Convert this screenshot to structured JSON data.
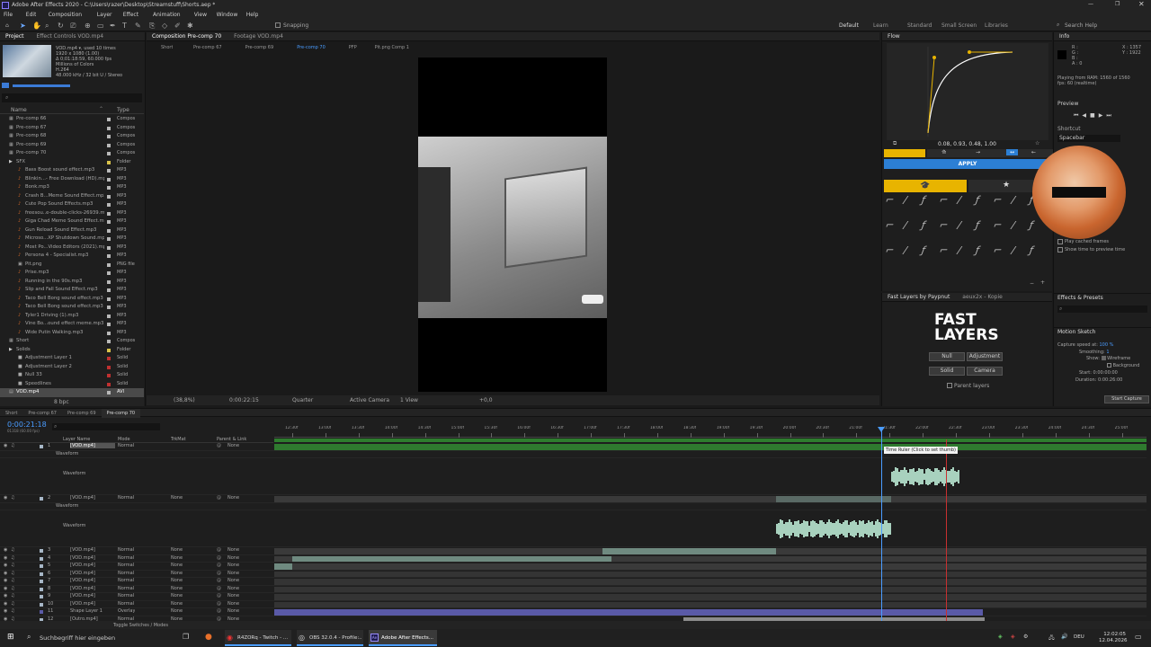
{
  "window": {
    "title": "Adobe After Effects 2020 - C:\\Users\\razer\\Desktop\\Streamstuff\\Shorts.aep *"
  },
  "menu": [
    "File",
    "Edit",
    "Composition",
    "Layer",
    "Effect",
    "Animation",
    "View",
    "Window",
    "Help"
  ],
  "toolbar": {
    "snapping": "Snapping",
    "workspaces": [
      "Default",
      "Learn",
      "Standard",
      "Small Screen",
      "Libraries"
    ],
    "search": "Search Help"
  },
  "project": {
    "tabs": [
      "Project",
      "Effect Controls VOD.mp4"
    ],
    "info": [
      "VOD.mp4 ▾, used 10 times",
      "1920 x 1080 (1.00)",
      "Δ 0;01:18:59, 60.000 fps",
      "Millions of Colors",
      "H.264",
      "48.000 kHz / 32 bit U / Stereo"
    ],
    "columns": {
      "name": "Name",
      "type": "Type"
    },
    "items": [
      {
        "name": "Pre-comp 66",
        "type": "Compos",
        "color": "#b8b8b8",
        "indent": 0,
        "kind": "comp"
      },
      {
        "name": "Pre-comp 67",
        "type": "Compos",
        "color": "#b8b8b8",
        "indent": 0,
        "kind": "comp"
      },
      {
        "name": "Pre-comp 68",
        "type": "Compos",
        "color": "#b8b8b8",
        "indent": 0,
        "kind": "comp"
      },
      {
        "name": "Pre-comp 69",
        "type": "Compos",
        "color": "#b8b8b8",
        "indent": 0,
        "kind": "comp"
      },
      {
        "name": "Pre-comp 70",
        "type": "Compos",
        "color": "#b8b8b8",
        "indent": 0,
        "kind": "comp"
      },
      {
        "name": "SFX",
        "type": "Folder",
        "color": "#d8c24a",
        "indent": 0,
        "kind": "folder"
      },
      {
        "name": "Bass Boost sound effect.mp3",
        "type": "MP3",
        "color": "#b8b8b8",
        "indent": 1,
        "kind": "audio"
      },
      {
        "name": "Blinkin...- Free Download (HD).mp3",
        "type": "MP3",
        "color": "#b8b8b8",
        "indent": 1,
        "kind": "audio"
      },
      {
        "name": "Bonk.mp3",
        "type": "MP3",
        "color": "#b8b8b8",
        "indent": 1,
        "kind": "audio"
      },
      {
        "name": "Crash B...Meme Sound Effect.mp3",
        "type": "MP3",
        "color": "#b8b8b8",
        "indent": 1,
        "kind": "audio"
      },
      {
        "name": "Cute Pop Sound Effects.mp3",
        "type": "MP3",
        "color": "#b8b8b8",
        "indent": 1,
        "kind": "audio"
      },
      {
        "name": "freesou..e-double-clicks-26939.mp3",
        "type": "MP3",
        "color": "#b8b8b8",
        "indent": 1,
        "kind": "audio"
      },
      {
        "name": "Giga Chad Meme Sound Effect.mp3",
        "type": "MP3",
        "color": "#b8b8b8",
        "indent": 1,
        "kind": "audio"
      },
      {
        "name": "Gun Reload Sound Effect.mp3",
        "type": "MP3",
        "color": "#b8b8b8",
        "indent": 1,
        "kind": "audio"
      },
      {
        "name": "Microso...XP Shutdown Sound.mp3",
        "type": "MP3",
        "color": "#b8b8b8",
        "indent": 1,
        "kind": "audio"
      },
      {
        "name": "Most Po...Video Editors (2021).mp3",
        "type": "MP3",
        "color": "#b8b8b8",
        "indent": 1,
        "kind": "audio"
      },
      {
        "name": "Persona 4 - Specialist.mp3",
        "type": "MP3",
        "color": "#b8b8b8",
        "indent": 1,
        "kind": "audio"
      },
      {
        "name": "Pit.png",
        "type": "PNG file",
        "color": "#b8b8b8",
        "indent": 1,
        "kind": "image"
      },
      {
        "name": "Prise.mp3",
        "type": "MP3",
        "color": "#b8b8b8",
        "indent": 1,
        "kind": "audio"
      },
      {
        "name": "Running in the 90s.mp3",
        "type": "MP3",
        "color": "#b8b8b8",
        "indent": 1,
        "kind": "audio"
      },
      {
        "name": "Slip and Fall Sound Effect.mp3",
        "type": "MP3",
        "color": "#b8b8b8",
        "indent": 1,
        "kind": "audio"
      },
      {
        "name": "Taco Bell Bong sound effect.mp3",
        "type": "MP3",
        "color": "#b8b8b8",
        "indent": 1,
        "kind": "audio"
      },
      {
        "name": "Taco Bell Bong sound effect.mp3",
        "type": "MP3",
        "color": "#b8b8b8",
        "indent": 1,
        "kind": "audio"
      },
      {
        "name": "Tyler1 Driving (1).mp3",
        "type": "MP3",
        "color": "#b8b8b8",
        "indent": 1,
        "kind": "audio"
      },
      {
        "name": "Vine Bo...ound effect meme.mp3",
        "type": "MP3",
        "color": "#b8b8b8",
        "indent": 1,
        "kind": "audio"
      },
      {
        "name": "Wide Putin Walking.mp3",
        "type": "MP3",
        "color": "#b8b8b8",
        "indent": 1,
        "kind": "audio"
      },
      {
        "name": "Short",
        "type": "Compos",
        "color": "#b8b8b8",
        "indent": 0,
        "kind": "comp"
      },
      {
        "name": "Solids",
        "type": "Folder",
        "color": "#d8c24a",
        "indent": 0,
        "kind": "folder"
      },
      {
        "name": "Adjustment Layer 1",
        "type": "Solid",
        "color": "#c03030",
        "indent": 1,
        "kind": "solid"
      },
      {
        "name": "Adjustment Layer 2",
        "type": "Solid",
        "color": "#c03030",
        "indent": 1,
        "kind": "solid"
      },
      {
        "name": "Null 33",
        "type": "Solid",
        "color": "#c03030",
        "indent": 1,
        "kind": "solid"
      },
      {
        "name": "Speedlines",
        "type": "Solid",
        "color": "#c03030",
        "indent": 1,
        "kind": "solid"
      },
      {
        "name": "VOD.mp4",
        "type": "AVI",
        "color": "#b8b8b8",
        "indent": 0,
        "kind": "video",
        "selected": true
      }
    ],
    "footer": "8 bpc"
  },
  "composition": {
    "tabs": [
      "Composition Pre-comp 70",
      "Footage VOD.mp4"
    ],
    "breadcrumbs": [
      "Short",
      "Pre-comp 67",
      "Pre-comp 69",
      "Pre-comp 70",
      "PFP",
      "Pit.png Comp 1"
    ],
    "footer": {
      "zoom": "(38,8%)",
      "time": "0:00:22:15",
      "resolution": "Quarter",
      "camera": "Active Camera",
      "view": "1 View",
      "exposure": "+0,0"
    }
  },
  "flow": {
    "title": "Flow",
    "values": "0.08, 0.93, 0.48, 1.00",
    "apply": "APPLY"
  },
  "info": {
    "title": "Info",
    "r": "R :",
    "g": "G :",
    "b": "B :",
    "a": "A : 0",
    "x": "X : 1357",
    "y": "Y : 1922",
    "playing": "Playing from RAM: 1560 of 1560",
    "fps": "fps: 60 (realtime)"
  },
  "preview": {
    "title": "Preview",
    "shortcut": "Shortcut",
    "key": "Spacebar",
    "cached": "Play cached frames",
    "show_time": "Show time to preview time"
  },
  "fastlayers": {
    "tabs": [
      "Fast Layers by Paypnut",
      "aeux2x - Kopie"
    ],
    "logo_top": "FAST",
    "logo_bottom": "LAYERS",
    "buttons": [
      "Null",
      "Adjustment",
      "Solid",
      "Camera"
    ],
    "parent": "Parent layers"
  },
  "effects": {
    "title": "Effects & Presets"
  },
  "motion_sketch": {
    "title": "Motion Sketch",
    "capture_label": "Capture speed at:",
    "capture_value": "100 %",
    "smoothing_label": "Smoothing:",
    "smoothing_value": "1",
    "show_label": "Show:",
    "wireframe": "Wireframe",
    "background": "Background",
    "start_label": "Start:",
    "start_value": "0:00:00:00",
    "duration_label": "Duration:",
    "duration_value": "0:00:26:00",
    "button": "Start Capture"
  },
  "timeline": {
    "tabs": [
      "Short",
      "Pre-comp 67",
      "Pre-comp 69",
      "Pre-comp 70"
    ],
    "timecode": "0:00:21:18",
    "timecode_sub": "01318 (60.00 fps)",
    "columns": {
      "name": "Layer Name",
      "mode": "Mode",
      "trkmat": "TrkMat",
      "parent": "Parent & Link"
    },
    "ruler": [
      "12:30f",
      "13:00f",
      "13:30f",
      "14:00f",
      "14:30f",
      "15:00f",
      "15:30f",
      "16:00f",
      "16:30f",
      "17:00f",
      "17:30f",
      "18:00f",
      "18:30f",
      "19:00f",
      "19:30f",
      "20:00f",
      "20:30f",
      "21:00f",
      "21:30f",
      "22:00f",
      "22:30f",
      "23:00f",
      "23:30f",
      "24:00f",
      "24:30f",
      "25:00f"
    ],
    "tooltip": "Time Ruler (Click to set thumb)",
    "footer": "Toggle Switches / Modes",
    "layers": [
      {
        "num": "1",
        "name": "[VOD.mp4]",
        "mode": "Normal",
        "trk": "",
        "parent": "None",
        "kind": "video"
      },
      {
        "num": "",
        "name": "Waveform",
        "mode": "",
        "trk": "",
        "parent": "",
        "kind": "sub"
      },
      {
        "num": "",
        "name": "Waveform",
        "mode": "",
        "trk": "",
        "parent": "",
        "kind": "wave"
      },
      {
        "num": "2",
        "name": "[VOD.mp4]",
        "mode": "Normal",
        "trk": "None",
        "parent": "None",
        "kind": "video"
      },
      {
        "num": "",
        "name": "Waveform",
        "mode": "",
        "trk": "",
        "parent": "",
        "kind": "sub"
      },
      {
        "num": "",
        "name": "Waveform",
        "mode": "",
        "trk": "",
        "parent": "",
        "kind": "wave"
      },
      {
        "num": "3",
        "name": "[VOD.mp4]",
        "mode": "Normal",
        "trk": "None",
        "parent": "None",
        "kind": "video"
      },
      {
        "num": "4",
        "name": "[VOD.mp4]",
        "mode": "Normal",
        "trk": "None",
        "parent": "None",
        "kind": "video"
      },
      {
        "num": "5",
        "name": "[VOD.mp4]",
        "mode": "Normal",
        "trk": "None",
        "parent": "None",
        "kind": "video"
      },
      {
        "num": "6",
        "name": "[VOD.mp4]",
        "mode": "Normal",
        "trk": "None",
        "parent": "None",
        "kind": "video"
      },
      {
        "num": "7",
        "name": "[VOD.mp4]",
        "mode": "Normal",
        "trk": "None",
        "parent": "None",
        "kind": "video"
      },
      {
        "num": "8",
        "name": "[VOD.mp4]",
        "mode": "Normal",
        "trk": "None",
        "parent": "None",
        "kind": "video"
      },
      {
        "num": "9",
        "name": "[VOD.mp4]",
        "mode": "Normal",
        "trk": "None",
        "parent": "None",
        "kind": "video"
      },
      {
        "num": "10",
        "name": "[VOD.mp4]",
        "mode": "Normal",
        "trk": "None",
        "parent": "None",
        "kind": "video"
      },
      {
        "num": "11",
        "name": "Shape Layer 1",
        "mode": "Overlay",
        "trk": "None",
        "parent": "None",
        "kind": "shape"
      },
      {
        "num": "12",
        "name": "[Outro.mp4]",
        "mode": "Normal",
        "trk": "None",
        "parent": "None",
        "kind": "video"
      },
      {
        "num": "13",
        "name": "[PFP]",
        "mode": "Normal",
        "trk": "None",
        "parent": "None",
        "kind": "video"
      }
    ]
  },
  "taskbar": {
    "search": "Suchbegriff hier eingeben",
    "apps": [
      "R4ZORq - Twitch - ...",
      "OBS 32.0.4 - Profile:...",
      "Adobe After Effects..."
    ],
    "lang": "DEU",
    "time": "12:02:05",
    "date": "12.04.2026"
  }
}
